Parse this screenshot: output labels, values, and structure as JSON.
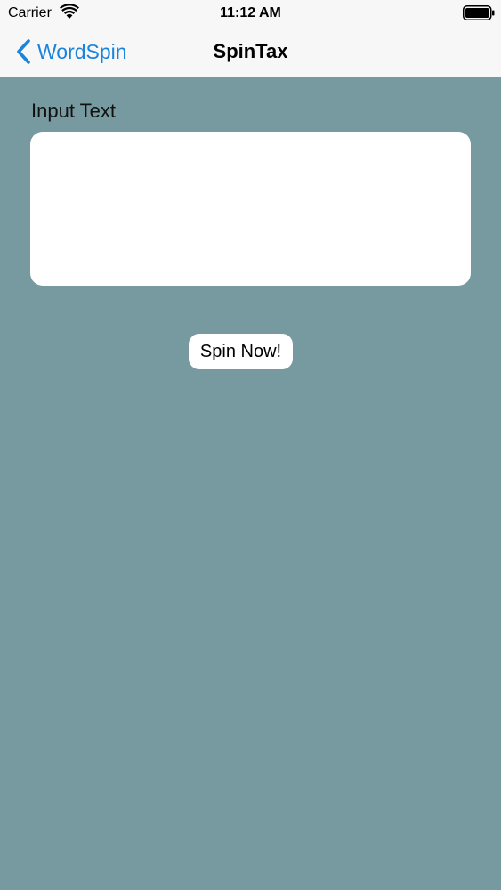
{
  "status_bar": {
    "carrier": "Carrier",
    "time": "11:12 AM",
    "wifi_icon": "wifi-icon",
    "battery_icon": "battery-full-icon"
  },
  "nav_bar": {
    "back_label": "WordSpin",
    "back_icon": "chevron-left-icon",
    "title": "SpinTax"
  },
  "form": {
    "input_label": "Input Text",
    "input_value": "",
    "spin_button_label": "Spin Now!"
  },
  "colors": {
    "background": "#779aa0",
    "bar_background": "#f7f7f8",
    "accent": "#1a84db",
    "field_background": "#ffffff"
  }
}
